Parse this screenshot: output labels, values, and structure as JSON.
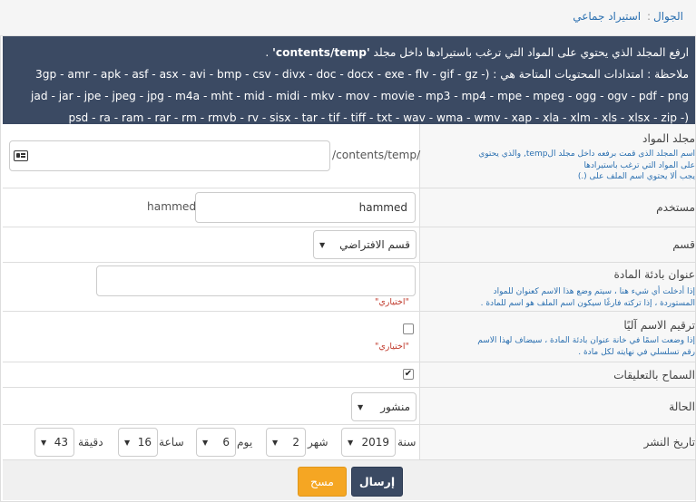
{
  "breadcrumb": {
    "home": "الجوال",
    "separator": ":",
    "current": "استيراد جماعي"
  },
  "notice": {
    "line1_prefix": "ارفع المجلد الذي يحتوي على المواد التي ترغب باستيرادها داخل مجلد",
    "line1_path": "'contents/temp'",
    "line1_suffix": ".",
    "line2": "ملاحظة : امتدادات المحتويات المتاحة هي : (- 3gp - amr - apk - asf - asx - avi - bmp - csv - divx - doc - docx - exe - flv - gif - gz",
    "line3": "jad - jar - jpe - jpeg - jpg - m4a - mht - mid - midi - mkv - mov - movie - mp3 - mp4 - mpe - mpeg - ogg - ogv - pdf - png",
    "line4": "(- psd - ra - ram - rar - rm - rmvb - rv - sisx - tar - tif - tiff - txt - wav - wma - wmv - xap - xla - xlm - xls - xlsx - zip"
  },
  "folder": {
    "label": "مجلد المواد",
    "help1": "اسم المجلد الذى قمت برفعه داخل مجلد الtemp, والذي يحتوي",
    "help2": "على المواد التي ترغب باستيرادها",
    "help3": "يجب ألا يحتوي اسم الملف على (.)",
    "prefix": "/contents/temp/",
    "value": "",
    "icon": "id-card-icon"
  },
  "user": {
    "label": "مستخدم",
    "value": "hammed",
    "display": "hammed"
  },
  "section": {
    "label": "قسم",
    "selected": "قسم الافتراضي"
  },
  "title_prefix": {
    "label": "عنوان بادئة المادة",
    "help1": "إذا أدخلت أي شيء هنا ، سيتم وضع هذا الاسم كعنوان للمواد",
    "help2": "المستوردة ، إذا تركته فارغًا سيكون اسم الملف هو اسم للمادة .",
    "optional": "\"اختياري\"",
    "value": ""
  },
  "auto_number": {
    "label": "ترقيم الاسم آليًا",
    "help1": "إذا وضعت اسمًا في خانة عنوان بادئة المادة ، سيضاف لهذا الاسم",
    "help2": "رقم تسلسلي في نهايته لكل مادة .",
    "optional": "\"اختياري\"",
    "checked": false
  },
  "comments": {
    "label": "السماح بالتعليقات",
    "checked": true,
    "mark": "✔"
  },
  "status": {
    "label": "الحالة",
    "selected": "منشور"
  },
  "publish_date": {
    "label": "تاريخ النشر",
    "year_label": "سنة",
    "year": "2019",
    "month_label": "شهر",
    "month": "2",
    "day_label": "يوم",
    "day": "6",
    "hour_label": "ساعة",
    "hour": "16",
    "minute_label": "دقيقة",
    "minute": "43"
  },
  "buttons": {
    "send": "إرسال",
    "clear": "مسح"
  },
  "select_arrow": "▼"
}
